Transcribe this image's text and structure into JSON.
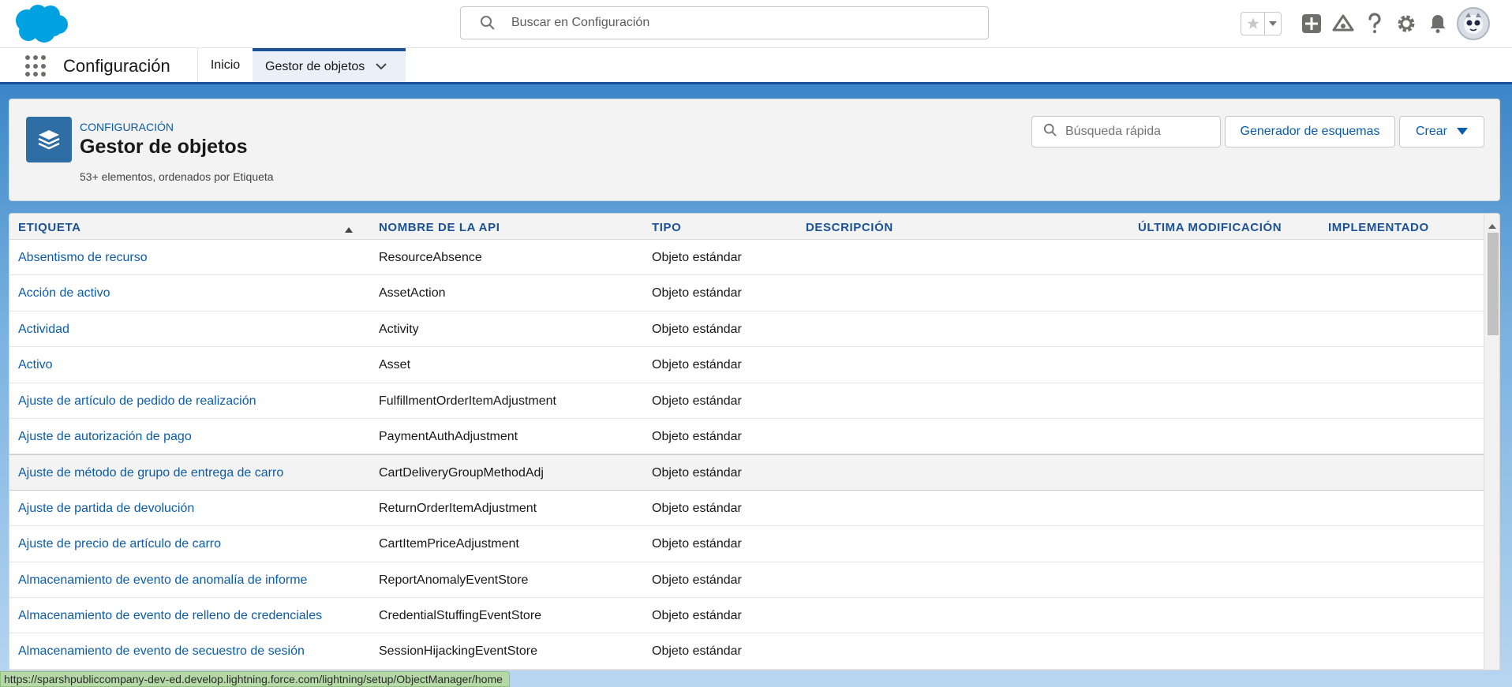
{
  "header": {
    "search_placeholder": "Buscar en Configuración"
  },
  "nav": {
    "app_name": "Configuración",
    "tabs": [
      {
        "label": "Inicio"
      },
      {
        "label": "Gestor de objetos"
      }
    ]
  },
  "page": {
    "breadcrumb": "CONFIGURACIÓN",
    "title": "Gestor de objetos",
    "subtitle": "53+ elementos, ordenados por Etiqueta",
    "quick_find_placeholder": "Búsqueda rápida",
    "schema_button": "Generador de esquemas",
    "create_button": "Crear"
  },
  "table": {
    "columns": [
      "ETIQUETA",
      "NOMBRE DE LA API",
      "TIPO",
      "DESCRIPCIÓN",
      "ÚLTIMA MODIFICACIÓN",
      "IMPLEMENTADO"
    ],
    "rows": [
      {
        "label": "Absentismo de recurso",
        "api": "ResourceAbsence",
        "type": "Objeto estándar"
      },
      {
        "label": "Acción de activo",
        "api": "AssetAction",
        "type": "Objeto estándar"
      },
      {
        "label": "Actividad",
        "api": "Activity",
        "type": "Objeto estándar"
      },
      {
        "label": "Activo",
        "api": "Asset",
        "type": "Objeto estándar"
      },
      {
        "label": "Ajuste de artículo de pedido de realización",
        "api": "FulfillmentOrderItemAdjustment",
        "type": "Objeto estándar"
      },
      {
        "label": "Ajuste de autorización de pago",
        "api": "PaymentAuthAdjustment",
        "type": "Objeto estándar"
      },
      {
        "label": "Ajuste de método de grupo de entrega de carro",
        "api": "CartDeliveryGroupMethodAdj",
        "type": "Objeto estándar"
      },
      {
        "label": "Ajuste de partida de devolución",
        "api": "ReturnOrderItemAdjustment",
        "type": "Objeto estándar"
      },
      {
        "label": "Ajuste de precio de artículo de carro",
        "api": "CartItemPriceAdjustment",
        "type": "Objeto estándar"
      },
      {
        "label": "Almacenamiento de evento de anomalía de informe",
        "api": "ReportAnomalyEventStore",
        "type": "Objeto estándar"
      },
      {
        "label": "Almacenamiento de evento de relleno de credenciales",
        "api": "CredentialStuffingEventStore",
        "type": "Objeto estándar"
      },
      {
        "label": "Almacenamiento de evento de secuestro de sesión",
        "api": "SessionHijackingEventStore",
        "type": "Objeto estándar"
      }
    ]
  },
  "status_bar": {
    "url": "https://sparshpubliccompany-dev-ed.develop.lightning.force.com/lightning/setup/ObjectManager/home"
  },
  "colors": {
    "brand": "#00a1e0",
    "link": "#0b5cab",
    "nav_accent": "#1b5297"
  }
}
